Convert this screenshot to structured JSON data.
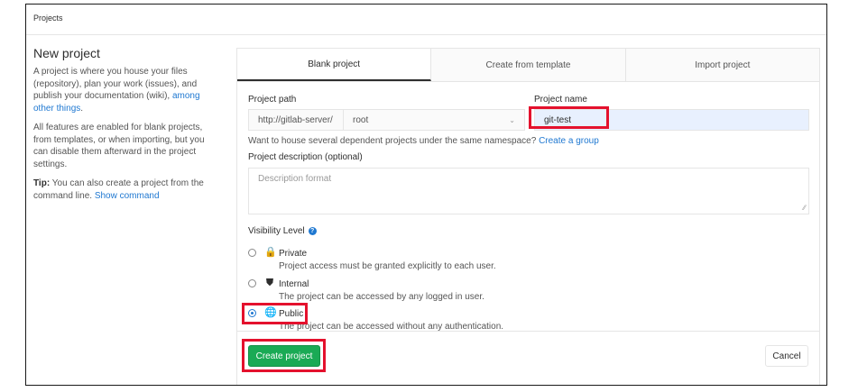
{
  "breadcrumb": "Projects",
  "intro": {
    "title": "New project",
    "p1_text": "A project is where you house your files (repository), plan your work (issues), and publish your documentation (wiki), ",
    "p1_link": "among other things",
    "p1_end": ".",
    "p2": "All features are enabled for blank projects, from templates, or when importing, but you can disable them afterward in the project settings.",
    "tip_label": "Tip:",
    "tip_text": " You can also create a project from the command line. ",
    "tip_link": "Show command"
  },
  "tabs": [
    {
      "label": "Blank project",
      "active": true
    },
    {
      "label": "Create from template",
      "active": false
    },
    {
      "label": "Import project",
      "active": false
    }
  ],
  "form": {
    "path_label": "Project path",
    "path_prefix": "http://gitlab-server/",
    "path_namespace": "root",
    "name_label": "Project name",
    "name_value": "git-test",
    "hint_text": "Want to house several dependent projects under the same namespace? ",
    "hint_link": "Create a group",
    "desc_label": "Project description (optional)",
    "desc_placeholder": "Description format",
    "visibility_label": "Visibility Level",
    "visibility": [
      {
        "title": "Private",
        "desc": "Project access must be granted explicitly to each user.",
        "icon": "lock-icon",
        "checked": false
      },
      {
        "title": "Internal",
        "desc": "The project can be accessed by any logged in user.",
        "icon": "shield-icon",
        "checked": false
      },
      {
        "title": "Public",
        "desc": "The project can be accessed without any authentication.",
        "icon": "globe-icon",
        "checked": true
      }
    ],
    "create_label": "Create project",
    "cancel_label": "Cancel"
  },
  "colors": {
    "accent": "#1f78d1",
    "success": "#1aaa55",
    "highlight": "#e4112d"
  }
}
